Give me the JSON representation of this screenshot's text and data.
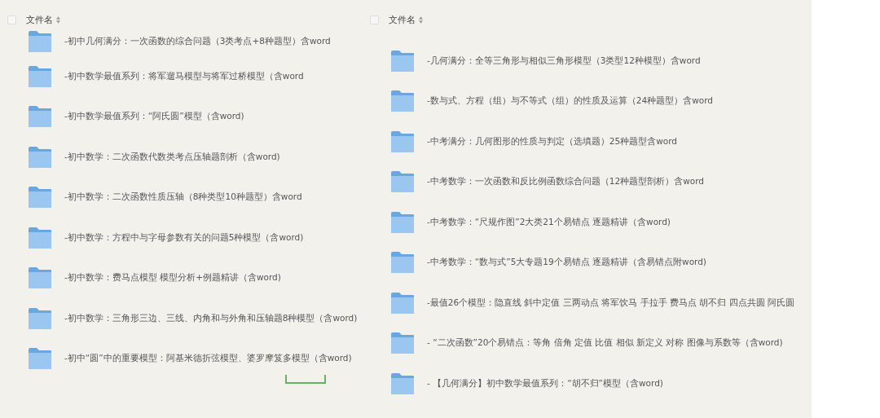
{
  "panels": [
    {
      "header": {
        "label": "文件名",
        "checked": false
      },
      "items": [
        {
          "name": "-初中几何满分：一次函数的综合问题（3类考点+8种题型）含word"
        },
        {
          "name": "-初中数学最值系列：将军遛马模型与将军过桥模型（含word"
        },
        {
          "name": "-初中数学最值系列：“阿氏圆”模型（含word)"
        },
        {
          "name": "-初中数学：二次函数代数类考点压轴题剖析（含word)"
        },
        {
          "name": "-初中数学：二次函数性质压轴（8种类型10种题型）含word"
        },
        {
          "name": "-初中数学：方程中与字母参数有关的问题5种模型（含word)"
        },
        {
          "name": "-初中数学：费马点模型 模型分析+例题精讲（含word)"
        },
        {
          "name": "-初中数学：三角形三边、三线、内角和与外角和压轴题8种模型（含word)"
        },
        {
          "name": "-初中“圆”中的重要模型：阿基米德折弦模型、婆罗摩笈多模型（含word)"
        }
      ]
    },
    {
      "header": {
        "label": "文件名",
        "checked": false
      },
      "items": [
        {
          "name": "-几何满分：全等三角形与相似三角形模型（3类型12种模型）含word"
        },
        {
          "name": "-数与式、方程（组）与不等式（组）的性质及运算（24种题型）含word"
        },
        {
          "name": "-中考满分：几何图形的性质与判定（选填题）25种题型含word"
        },
        {
          "name": "-中考数学：一次函数和反比例函数综合问题（12种题型剖析）含word"
        },
        {
          "name": "-中考数学：“尺规作图”2大类21个易错点 逐题精讲（含word)"
        },
        {
          "name": "-中考数学：“数与式”5大专题19个易错点 逐题精讲（含易错点附word)"
        },
        {
          "name": "-最值26个模型：隐直线 斜中定值 三两动点 将军饮马 手拉手 费马点 胡不归 四点共圆 阿氏圆"
        },
        {
          "name": "- “二次函数”20个易错点：等角 倍角 定值 比值 相似 新定义 对称 图像与系数等（含word)"
        },
        {
          "name": "- 【几何满分】初中数学最值系列：“胡不归”模型（含word)"
        }
      ]
    }
  ]
}
